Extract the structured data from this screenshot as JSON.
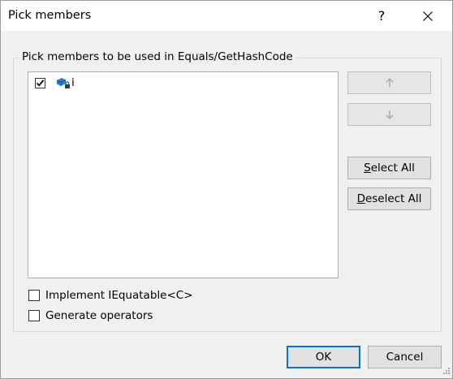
{
  "window": {
    "title": "Pick members",
    "help_label": "?"
  },
  "group": {
    "legend": "Pick members to be used in Equals/GetHashCode"
  },
  "members": [
    {
      "name": "i",
      "checked": true,
      "icon": "field-icon"
    }
  ],
  "buttons": {
    "select_all_mnemonic": "S",
    "select_all_rest": "elect All",
    "deselect_all_mnemonic": "D",
    "deselect_all_rest": "eselect All",
    "ok": "OK",
    "cancel": "Cancel"
  },
  "options": {
    "implement_iequatable": {
      "label": "Implement IEquatable<C>",
      "checked": false
    },
    "generate_operators": {
      "label": "Generate operators",
      "checked": false
    }
  },
  "colors": {
    "accent": "#0078d7",
    "dialog_bg": "#f0f0f0",
    "title_bg": "#ffffff"
  }
}
